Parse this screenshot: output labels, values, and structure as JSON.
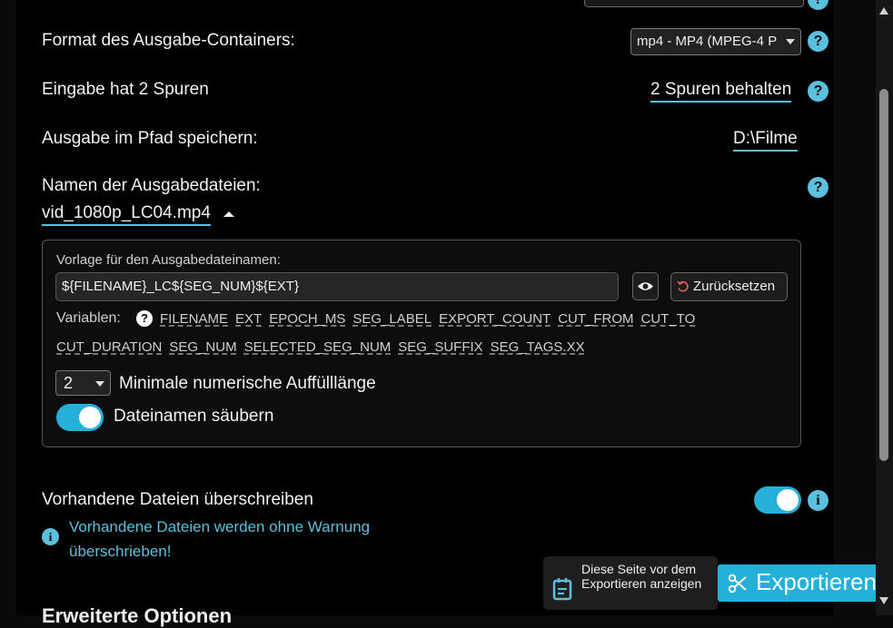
{
  "format_row": {
    "label": "Format des Ausgabe-Containers:",
    "selected": "mp4 - MP4 (MPEG-4 P"
  },
  "tracks_row": {
    "label": "Eingabe hat 2 Spuren",
    "value": "2 Spuren behalten"
  },
  "path_row": {
    "label": "Ausgabe im Pfad speichern:",
    "value": "D:\\Filme"
  },
  "names_row": {
    "label": "Namen der Ausgabedateien:",
    "filename": "vid_1080p_LC04.mp4"
  },
  "template_box": {
    "title": "Vorlage für den Ausgabedateinamen:",
    "template_value": "${FILENAME}_LC${SEG_NUM}${EXT}",
    "reset_label": "Zurücksetzen",
    "variables_label": "Variablen:",
    "variables_line1": [
      "FILENAME",
      "EXT",
      "EPOCH_MS",
      "SEG_LABEL",
      "EXPORT_COUNT",
      "CUT_FROM",
      "CUT_TO"
    ],
    "variables_line2": [
      "CUT_DURATION",
      "SEG_NUM",
      "SELECTED_SEG_NUM",
      "SEG_SUFFIX",
      "SEG_TAGS.XX"
    ],
    "padding_value": "2",
    "padding_label": "Minimale numerische Auffülllänge",
    "sanitize_label": "Dateinamen säubern"
  },
  "overwrite_row": {
    "label": "Vorhandene Dateien überschreiben",
    "warning": "Vorhandene Dateien werden ohne Warnung überschrieben!"
  },
  "footer": {
    "show_page_text": "Diese Seite vor dem Exportieren anzeigen",
    "export_label": "Exportieren",
    "partial_heading": "Erweiterte Optionen"
  },
  "icons": {
    "help": "?",
    "info": "i"
  },
  "colors": {
    "accent": "#24b0d8",
    "help_badge": "#5bc0de",
    "reset_icon": "#e06060"
  }
}
